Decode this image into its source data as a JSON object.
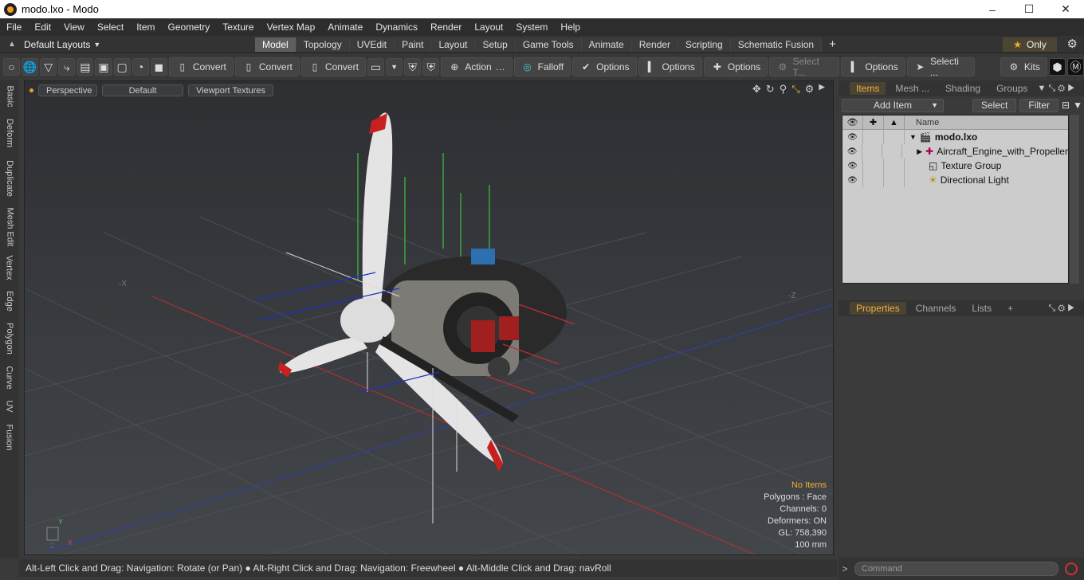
{
  "window": {
    "title": "modo.lxo - Modo",
    "controls": [
      "–",
      "☐",
      "✕"
    ]
  },
  "menu": [
    "File",
    "Edit",
    "View",
    "Select",
    "Item",
    "Geometry",
    "Texture",
    "Vertex Map",
    "Animate",
    "Dynamics",
    "Render",
    "Layout",
    "System",
    "Help"
  ],
  "layoutbar": {
    "layouts_label": "Default Layouts",
    "tabs": [
      "Model",
      "Topology",
      "UVEdit",
      "Paint",
      "Layout",
      "Setup",
      "Game Tools",
      "Animate",
      "Render",
      "Scripting",
      "Schematic Fusion"
    ],
    "active_tab": "Model",
    "only_label": "Only"
  },
  "toolbar": {
    "convert1": "Convert",
    "convert2": "Convert",
    "convert3": "Convert",
    "action": "Action",
    "falloff": "Falloff",
    "options1": "Options",
    "options2": "Options",
    "options3": "Options",
    "options4": "Options",
    "select_t": "Select T...",
    "selecti": "Selecti ...",
    "kits": "Kits"
  },
  "left_tabs": [
    "Basic",
    "Deform",
    "Duplicate",
    "Mesh Edit",
    "Vertex",
    "Edge",
    "Polygon",
    "Curve",
    "UV",
    "Fusion"
  ],
  "viewport": {
    "view": "Perspective",
    "shading": "Default",
    "textures": "Viewport Textures",
    "axis_labels": {
      "neg_x": "-X",
      "neg_z": "-Z",
      "y": "Y",
      "x": "X",
      "z": "Z"
    },
    "info": {
      "no_items": "No Items",
      "polygons": "Polygons : Face",
      "channels": "Channels: 0",
      "deformers": "Deformers: ON",
      "gl": "GL: 758,390",
      "scale": "100 mm"
    }
  },
  "items_panel": {
    "tabs": [
      "Items",
      "Mesh ...",
      "Shading",
      "Groups"
    ],
    "active_tab": "Items",
    "add_item": "Add Item",
    "select": "Select",
    "filter": "Filter",
    "column_name": "Name",
    "rows": [
      {
        "label": "modo.lxo",
        "bold": true
      },
      {
        "label": "Aircraft_Engine_with_Propeller",
        "bold": false
      },
      {
        "label": "Texture Group",
        "bold": false
      },
      {
        "label": "Directional Light",
        "bold": false
      }
    ]
  },
  "props_panel": {
    "tabs": [
      "Properties",
      "Channels",
      "Lists"
    ],
    "active_tab": "Properties"
  },
  "command": {
    "placeholder": "Command"
  },
  "status": "Alt-Left Click and Drag: Navigation: Rotate (or Pan) ● Alt-Right Click and Drag: Navigation: Freewheel ● Alt-Middle Click and Drag: navRoll",
  "colors": {
    "accent": "#f0b030",
    "axis_x": "#c03030",
    "axis_z": "#3050c0",
    "axis_y": "#40c040"
  }
}
